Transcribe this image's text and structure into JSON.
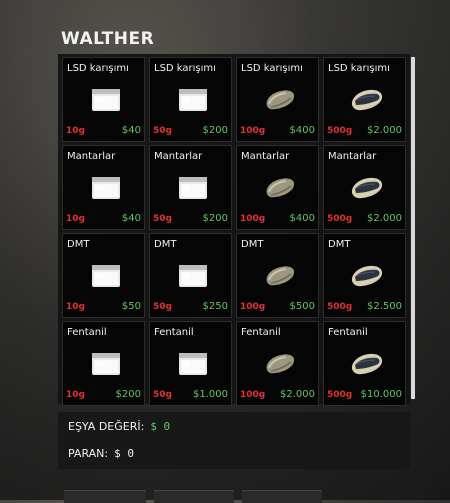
{
  "vendor": {
    "title": "WALTHER"
  },
  "items": [
    {
      "name": "LSD karışımı",
      "qty": "10g",
      "price": "$40",
      "icon": "small-bag-icon"
    },
    {
      "name": "LSD karışımı",
      "qty": "50g",
      "price": "$200",
      "icon": "small-bag-icon"
    },
    {
      "name": "LSD karışımı",
      "qty": "100g",
      "price": "$400",
      "icon": "brick-icon"
    },
    {
      "name": "LSD karışımı",
      "qty": "500g",
      "price": "$2.000",
      "icon": "large-brick-icon"
    },
    {
      "name": "Mantarlar",
      "qty": "10g",
      "price": "$40",
      "icon": "small-bag-icon"
    },
    {
      "name": "Mantarlar",
      "qty": "50g",
      "price": "$200",
      "icon": "small-bag-icon"
    },
    {
      "name": "Mantarlar",
      "qty": "100g",
      "price": "$400",
      "icon": "brick-icon"
    },
    {
      "name": "Mantarlar",
      "qty": "500g",
      "price": "$2.000",
      "icon": "large-brick-icon"
    },
    {
      "name": "DMT",
      "qty": "10g",
      "price": "$50",
      "icon": "small-bag-icon"
    },
    {
      "name": "DMT",
      "qty": "50g",
      "price": "$250",
      "icon": "small-bag-icon"
    },
    {
      "name": "DMT",
      "qty": "100g",
      "price": "$500",
      "icon": "brick-icon"
    },
    {
      "name": "DMT",
      "qty": "500g",
      "price": "$2.500",
      "icon": "large-brick-icon"
    },
    {
      "name": "Fentanil",
      "qty": "10g",
      "price": "$200",
      "icon": "small-bag-icon"
    },
    {
      "name": "Fentanil",
      "qty": "50g",
      "price": "$1.000",
      "icon": "small-bag-icon"
    },
    {
      "name": "Fentanil",
      "qty": "100g",
      "price": "$2.000",
      "icon": "brick-icon"
    },
    {
      "name": "Fentanil",
      "qty": "500g",
      "price": "$10.000",
      "icon": "large-brick-icon"
    }
  ],
  "summary": {
    "item_value_label": "EŞYA DEĞERİ:",
    "item_value": "$ 0",
    "money_label": "PARAN:",
    "money": "$ 0"
  },
  "colors": {
    "qty_red": "#e23030",
    "price_green": "#5ec95e",
    "cell_bg": "#050505"
  }
}
